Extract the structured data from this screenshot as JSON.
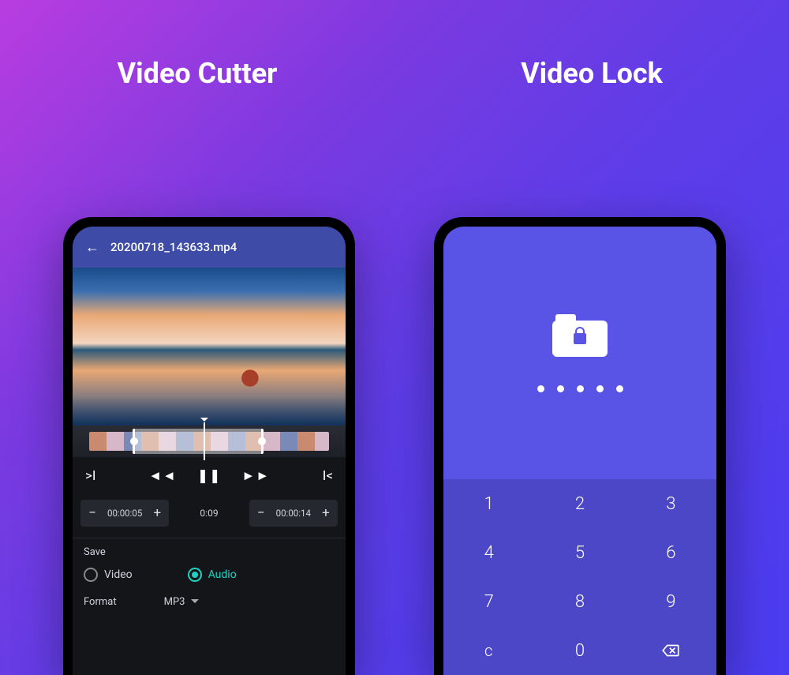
{
  "headings": {
    "cutter": "Video Cutter",
    "lock": "Video Lock"
  },
  "cutter": {
    "filename": "20200718_143633.mp4",
    "times": {
      "start": "00:00:05",
      "current": "0:09",
      "end": "00:00:14"
    },
    "save_label": "Save",
    "radio_video": "Video",
    "radio_audio": "Audio",
    "format_label": "Format",
    "format_value": "MP3"
  },
  "lock": {
    "pin_length": 5,
    "keypad": [
      "1",
      "2",
      "3",
      "4",
      "5",
      "6",
      "7",
      "8",
      "9",
      "c",
      "0",
      "backspace"
    ]
  }
}
